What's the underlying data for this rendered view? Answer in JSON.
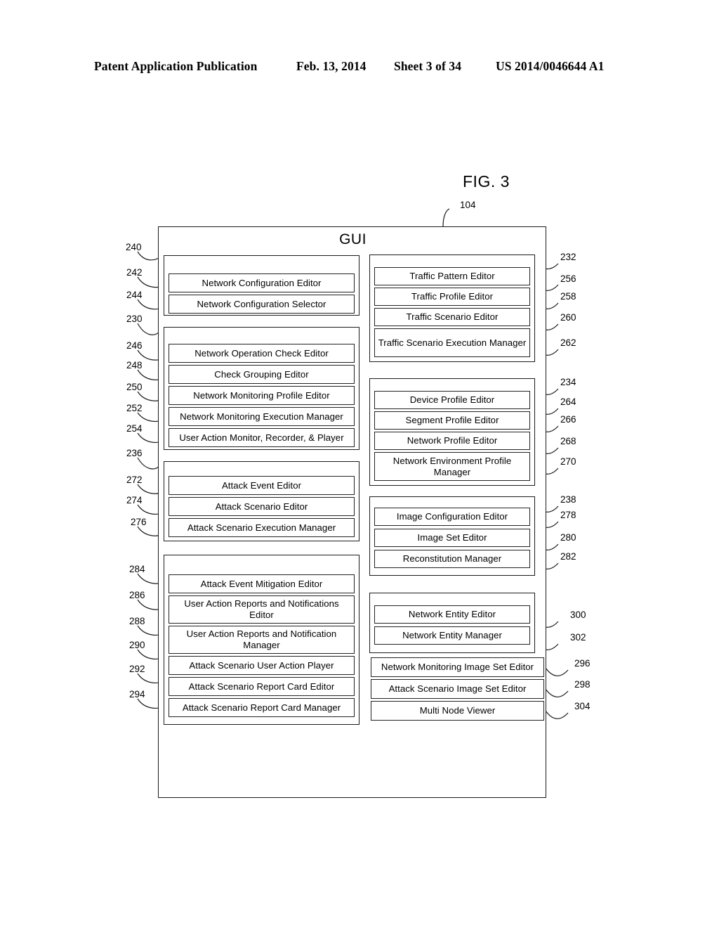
{
  "page_header": {
    "publication": "Patent Application Publication",
    "date": "Feb. 13, 2014",
    "sheet": "Sheet 3 of 34",
    "patent_number": "US 2014/0046644 A1"
  },
  "figure": {
    "title": "FIG. 3",
    "gui_label": "GUI",
    "gui_ref": "104"
  },
  "left_column": {
    "groups": [
      {
        "ref": "240",
        "items": [
          {
            "ref": "242",
            "label": "Network Configuration Editor"
          },
          {
            "ref": "244",
            "label": "Network Configuration Selector"
          }
        ]
      },
      {
        "ref": "230",
        "items": [
          {
            "ref": "246",
            "label": "Network Operation Check Editor"
          },
          {
            "ref": "248",
            "label": "Check Grouping Editor"
          },
          {
            "ref": "250",
            "label": "Network Monitoring Profile Editor"
          },
          {
            "ref": "252",
            "label": "Network Monitoring Execution Manager"
          },
          {
            "ref": "254",
            "label": "User Action Monitor, Recorder, & Player"
          }
        ]
      },
      {
        "ref": "236",
        "items": [
          {
            "ref": "272",
            "label": "Attack Event Editor"
          },
          {
            "ref": "274",
            "label": "Attack Scenario Editor"
          },
          {
            "ref": "276",
            "label": "Attack Scenario Execution Manager"
          }
        ]
      },
      {
        "ref": "",
        "items": [
          {
            "ref": "284",
            "label": "Attack Event Mitigation Editor"
          },
          {
            "ref": "286",
            "label": "User Action Reports and Notifications Editor"
          },
          {
            "ref": "288",
            "label": "User Action Reports and Notification Manager"
          },
          {
            "ref": "290",
            "label": "Attack Scenario User Action Player"
          },
          {
            "ref": "292",
            "label": "Attack Scenario Report Card Editor"
          },
          {
            "ref": "294",
            "label": "Attack Scenario Report Card Manager"
          }
        ]
      }
    ]
  },
  "right_column": {
    "groups": [
      {
        "ref": "232",
        "items": [
          {
            "ref": "256",
            "label": "Traffic Pattern Editor"
          },
          {
            "ref": "258",
            "label": "Traffic Profile Editor"
          },
          {
            "ref": "260",
            "label": "Traffic Scenario Editor"
          },
          {
            "ref": "262",
            "label": "Traffic Scenario Execution Manager"
          }
        ]
      },
      {
        "ref": "234",
        "items": [
          {
            "ref": "264",
            "label": "Device Profile Editor"
          },
          {
            "ref": "266",
            "label": "Segment Profile Editor"
          },
          {
            "ref": "268",
            "label": "Network Profile Editor"
          },
          {
            "ref": "270",
            "label": "Network Environment Profile Manager"
          }
        ]
      },
      {
        "ref": "238",
        "items": [
          {
            "ref": "278",
            "label": "Image Configuration Editor"
          },
          {
            "ref": "280",
            "label": "Image Set Editor"
          },
          {
            "ref": "282",
            "label": "Reconstitution Manager"
          }
        ]
      },
      {
        "ref": "",
        "items": [
          {
            "ref": "300",
            "label": "Network Entity Editor"
          },
          {
            "ref": "302",
            "label": "Network Entity Manager"
          }
        ]
      }
    ],
    "standalone": [
      {
        "ref": "296",
        "label": "Network Monitoring Image Set Editor"
      },
      {
        "ref": "298",
        "label": "Attack Scenario Image Set Editor"
      },
      {
        "ref": "304",
        "label": "Multi Node Viewer"
      }
    ]
  }
}
